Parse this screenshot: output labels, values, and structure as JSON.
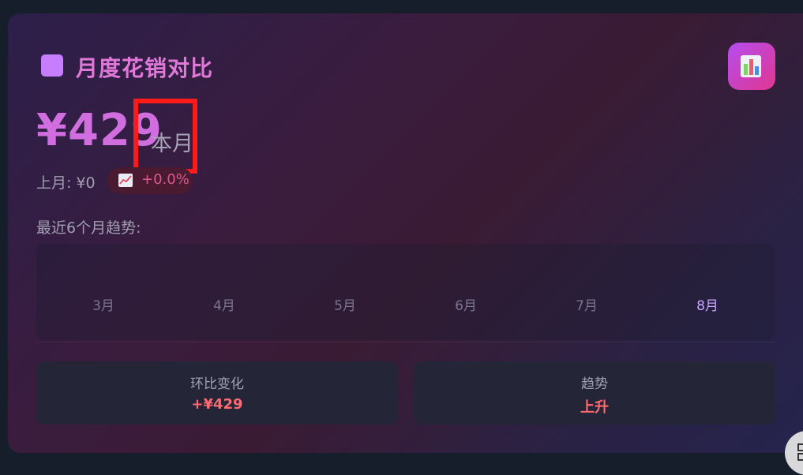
{
  "header": {
    "title": "月度花销对比",
    "accent_color": "#c77dff",
    "app_icon": "bar-chart-icon"
  },
  "summary": {
    "amount": "¥429",
    "period_label": "本月",
    "previous_month": "上月: ¥0",
    "change_percent": "+0.0%",
    "change_icon": "chart-increasing-icon"
  },
  "trend": {
    "label": "最近6个月趋势:",
    "months": [
      "3月",
      "4月",
      "5月",
      "6月",
      "7月",
      "8月"
    ],
    "active_month": "8月"
  },
  "stats": [
    {
      "label": "环比变化",
      "value": "+¥429"
    },
    {
      "label": "趋势",
      "value": "上升"
    }
  ],
  "colors": {
    "positive": "#ff6b70",
    "title": "#e078d8",
    "highlight_box": "#ff1a1a"
  }
}
